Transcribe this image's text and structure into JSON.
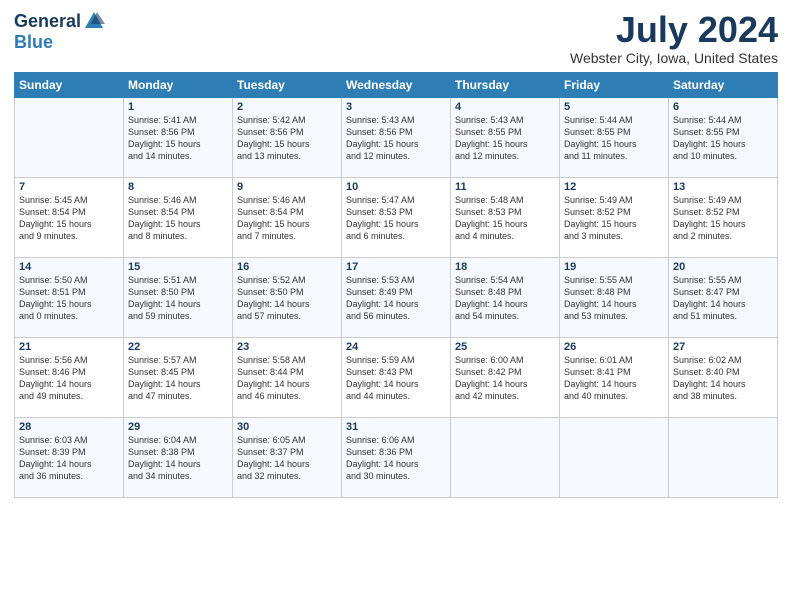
{
  "logo": {
    "general": "General",
    "blue": "Blue"
  },
  "title": "July 2024",
  "location": "Webster City, Iowa, United States",
  "days_header": [
    "Sunday",
    "Monday",
    "Tuesday",
    "Wednesday",
    "Thursday",
    "Friday",
    "Saturday"
  ],
  "weeks": [
    [
      {
        "day": "",
        "content": ""
      },
      {
        "day": "1",
        "content": "Sunrise: 5:41 AM\nSunset: 8:56 PM\nDaylight: 15 hours\nand 14 minutes."
      },
      {
        "day": "2",
        "content": "Sunrise: 5:42 AM\nSunset: 8:56 PM\nDaylight: 15 hours\nand 13 minutes."
      },
      {
        "day": "3",
        "content": "Sunrise: 5:43 AM\nSunset: 8:56 PM\nDaylight: 15 hours\nand 12 minutes."
      },
      {
        "day": "4",
        "content": "Sunrise: 5:43 AM\nSunset: 8:55 PM\nDaylight: 15 hours\nand 12 minutes."
      },
      {
        "day": "5",
        "content": "Sunrise: 5:44 AM\nSunset: 8:55 PM\nDaylight: 15 hours\nand 11 minutes."
      },
      {
        "day": "6",
        "content": "Sunrise: 5:44 AM\nSunset: 8:55 PM\nDaylight: 15 hours\nand 10 minutes."
      }
    ],
    [
      {
        "day": "7",
        "content": "Sunrise: 5:45 AM\nSunset: 8:54 PM\nDaylight: 15 hours\nand 9 minutes."
      },
      {
        "day": "8",
        "content": "Sunrise: 5:46 AM\nSunset: 8:54 PM\nDaylight: 15 hours\nand 8 minutes."
      },
      {
        "day": "9",
        "content": "Sunrise: 5:46 AM\nSunset: 8:54 PM\nDaylight: 15 hours\nand 7 minutes."
      },
      {
        "day": "10",
        "content": "Sunrise: 5:47 AM\nSunset: 8:53 PM\nDaylight: 15 hours\nand 6 minutes."
      },
      {
        "day": "11",
        "content": "Sunrise: 5:48 AM\nSunset: 8:53 PM\nDaylight: 15 hours\nand 4 minutes."
      },
      {
        "day": "12",
        "content": "Sunrise: 5:49 AM\nSunset: 8:52 PM\nDaylight: 15 hours\nand 3 minutes."
      },
      {
        "day": "13",
        "content": "Sunrise: 5:49 AM\nSunset: 8:52 PM\nDaylight: 15 hours\nand 2 minutes."
      }
    ],
    [
      {
        "day": "14",
        "content": "Sunrise: 5:50 AM\nSunset: 8:51 PM\nDaylight: 15 hours\nand 0 minutes."
      },
      {
        "day": "15",
        "content": "Sunrise: 5:51 AM\nSunset: 8:50 PM\nDaylight: 14 hours\nand 59 minutes."
      },
      {
        "day": "16",
        "content": "Sunrise: 5:52 AM\nSunset: 8:50 PM\nDaylight: 14 hours\nand 57 minutes."
      },
      {
        "day": "17",
        "content": "Sunrise: 5:53 AM\nSunset: 8:49 PM\nDaylight: 14 hours\nand 56 minutes."
      },
      {
        "day": "18",
        "content": "Sunrise: 5:54 AM\nSunset: 8:48 PM\nDaylight: 14 hours\nand 54 minutes."
      },
      {
        "day": "19",
        "content": "Sunrise: 5:55 AM\nSunset: 8:48 PM\nDaylight: 14 hours\nand 53 minutes."
      },
      {
        "day": "20",
        "content": "Sunrise: 5:55 AM\nSunset: 8:47 PM\nDaylight: 14 hours\nand 51 minutes."
      }
    ],
    [
      {
        "day": "21",
        "content": "Sunrise: 5:56 AM\nSunset: 8:46 PM\nDaylight: 14 hours\nand 49 minutes."
      },
      {
        "day": "22",
        "content": "Sunrise: 5:57 AM\nSunset: 8:45 PM\nDaylight: 14 hours\nand 47 minutes."
      },
      {
        "day": "23",
        "content": "Sunrise: 5:58 AM\nSunset: 8:44 PM\nDaylight: 14 hours\nand 46 minutes."
      },
      {
        "day": "24",
        "content": "Sunrise: 5:59 AM\nSunset: 8:43 PM\nDaylight: 14 hours\nand 44 minutes."
      },
      {
        "day": "25",
        "content": "Sunrise: 6:00 AM\nSunset: 8:42 PM\nDaylight: 14 hours\nand 42 minutes."
      },
      {
        "day": "26",
        "content": "Sunrise: 6:01 AM\nSunset: 8:41 PM\nDaylight: 14 hours\nand 40 minutes."
      },
      {
        "day": "27",
        "content": "Sunrise: 6:02 AM\nSunset: 8:40 PM\nDaylight: 14 hours\nand 38 minutes."
      }
    ],
    [
      {
        "day": "28",
        "content": "Sunrise: 6:03 AM\nSunset: 8:39 PM\nDaylight: 14 hours\nand 36 minutes."
      },
      {
        "day": "29",
        "content": "Sunrise: 6:04 AM\nSunset: 8:38 PM\nDaylight: 14 hours\nand 34 minutes."
      },
      {
        "day": "30",
        "content": "Sunrise: 6:05 AM\nSunset: 8:37 PM\nDaylight: 14 hours\nand 32 minutes."
      },
      {
        "day": "31",
        "content": "Sunrise: 6:06 AM\nSunset: 8:36 PM\nDaylight: 14 hours\nand 30 minutes."
      },
      {
        "day": "",
        "content": ""
      },
      {
        "day": "",
        "content": ""
      },
      {
        "day": "",
        "content": ""
      }
    ]
  ]
}
